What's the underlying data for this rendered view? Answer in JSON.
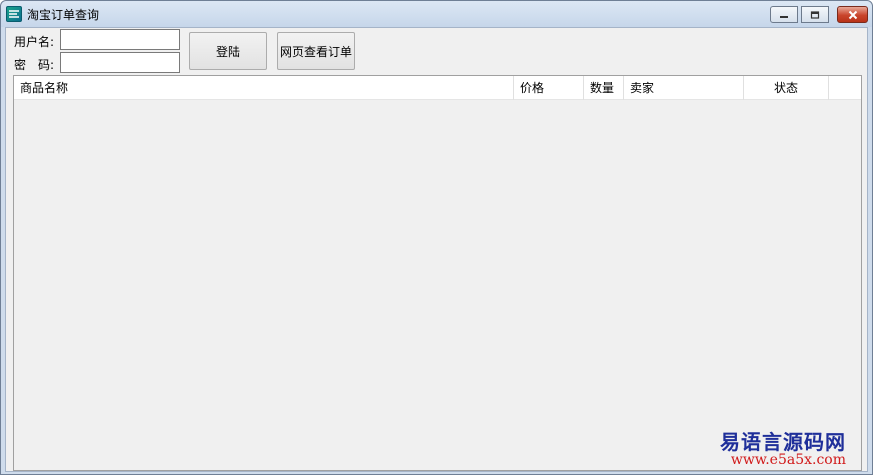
{
  "window": {
    "title": "淘宝订单查询",
    "icon": "app-logo-icon",
    "controls": [
      "minimize-icon",
      "maximize-icon",
      "close-icon"
    ]
  },
  "form": {
    "username_label": "用户名:",
    "username_value": "",
    "password_label": "密　码:",
    "password_value": "",
    "login_button": "登陆",
    "view_web_button": "网页查看订单"
  },
  "table": {
    "columns": [
      "商品名称",
      "价格",
      "数量",
      "卖家",
      "状态",
      ""
    ],
    "rows": []
  },
  "watermark": {
    "name": "易语言源码网",
    "url": "www.e5a5x.com"
  }
}
